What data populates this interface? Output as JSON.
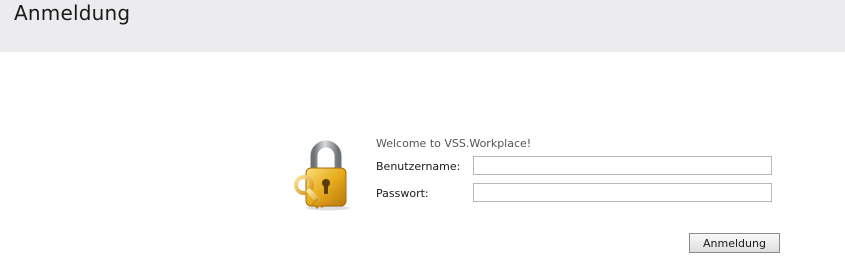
{
  "header": {
    "title": "Anmeldung"
  },
  "login": {
    "welcome_text": "Welcome to VSS.Workplace!",
    "username_label": "Benutzername:",
    "username_value": "",
    "password_label": "Passwort:",
    "password_value": "",
    "submit_label": "Anmeldung",
    "icon": "lock-with-key-icon"
  },
  "colors": {
    "header_bg": "#ececef",
    "lock_gold": "#e0a817",
    "lock_shackle": "#8f9398"
  }
}
